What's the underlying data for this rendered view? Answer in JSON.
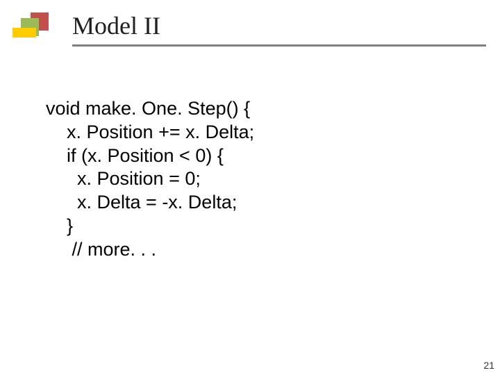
{
  "slide": {
    "title": "Model II",
    "page_number": "21"
  },
  "code": {
    "l1": "void make. One. Step() {",
    "l2": "    x. Position += x. Delta;",
    "l3": "    if (x. Position < 0) {",
    "l4": "      x. Position = 0;",
    "l5": "      x. Delta = -x. Delta;",
    "l6": "    }",
    "l7": "     // more. . ."
  }
}
